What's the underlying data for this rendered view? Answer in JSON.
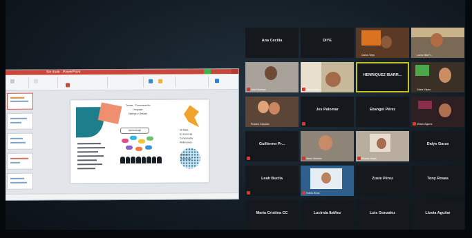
{
  "ppt": {
    "title": "Sin título - PowerPoint",
    "slide": {
      "heading_lines": [
        "Temas · Comunicación",
        "Lenguaje",
        "Dialogo y Debate"
      ],
      "badge": "Aprendizaje",
      "side_list": [
        "Mi Meta",
        "Es Esencial",
        "Comprender",
        "Reflexionar",
        "Debatir",
        "Participar"
      ]
    }
  },
  "zoom": {
    "tiles": [
      {
        "name": "Ana Cecilia",
        "video": false
      },
      {
        "name": "DIYE",
        "video": false
      },
      {
        "name": "",
        "video": true,
        "label": "Carlos Vieja"
      },
      {
        "name": "",
        "video": true,
        "label": "Lucía Villa Fr..."
      },
      {
        "name": "",
        "video": true,
        "label": "Julia Montoya"
      },
      {
        "name": "",
        "video": true,
        "label": "Ivonne Silva"
      },
      {
        "name": "HENRIQUEZ IBARR...",
        "video": false
      },
      {
        "name": "",
        "video": true,
        "label": "Gloria Yépez"
      },
      {
        "name": "",
        "video": true,
        "label": "Rosario Vázquez"
      },
      {
        "name": "Jes Palomar",
        "video": false
      },
      {
        "name": "Ebangel Pérez",
        "video": false
      },
      {
        "name": "",
        "video": true,
        "label": "Miriam Aguirre"
      },
      {
        "name": "Guillermo Pr...",
        "video": false
      },
      {
        "name": "",
        "video": true,
        "label": "Iliana Sánchez"
      },
      {
        "name": "",
        "video": true,
        "label": "Ricardo Maya"
      },
      {
        "name": "Dalys Garza",
        "video": false
      },
      {
        "name": "Leah Bucila",
        "video": false
      },
      {
        "name": "",
        "video": true,
        "label": "Estela Rivas"
      },
      {
        "name": "Zusie Pérez",
        "video": false
      },
      {
        "name": "Tony Rosas",
        "video": false
      },
      {
        "name": "María Cristina CC",
        "video": false
      },
      {
        "name": "Lucinda Ibáñez",
        "video": false
      },
      {
        "name": "Luis Gonzalez",
        "video": false
      },
      {
        "name": "Lluvia Aguilar",
        "video": false
      }
    ]
  }
}
